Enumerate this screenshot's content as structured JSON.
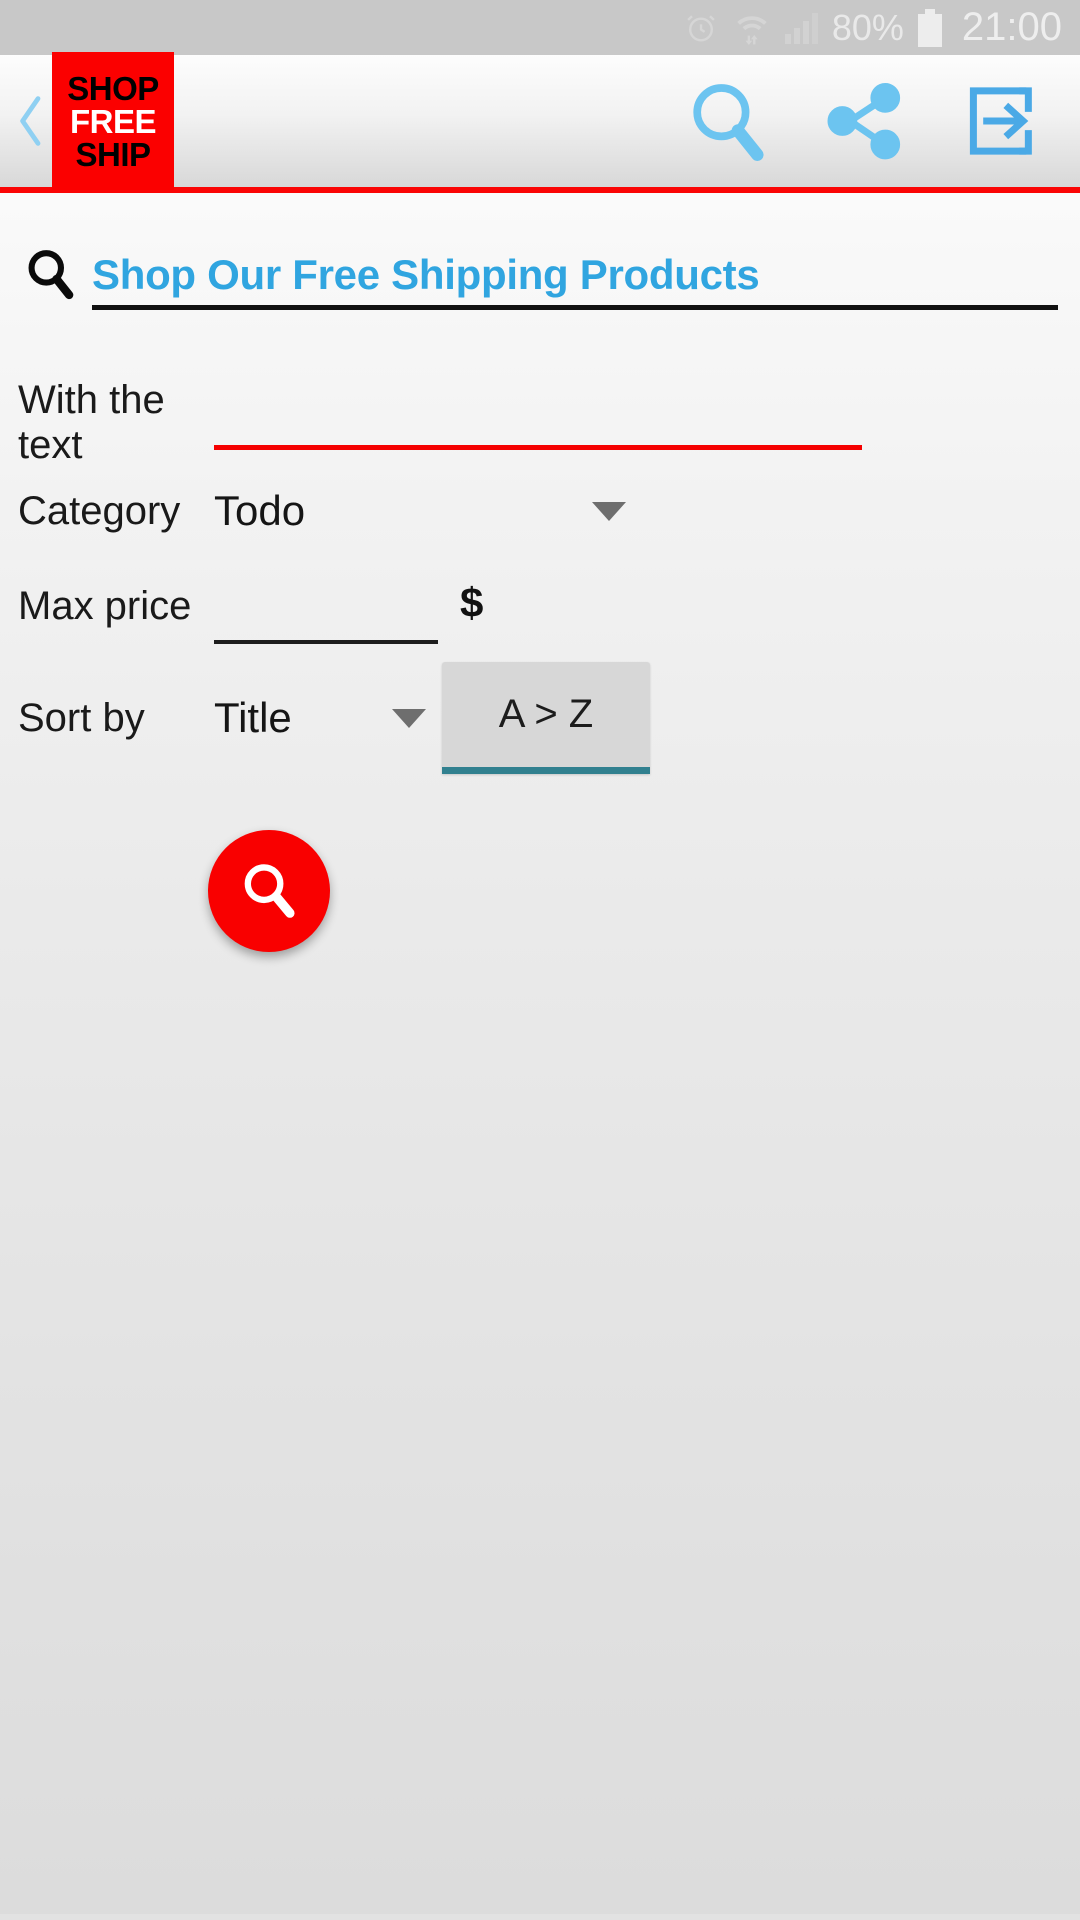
{
  "status_bar": {
    "battery_percent": "80%",
    "time": "21:00",
    "icons": [
      "alarm-icon",
      "wifi-icon",
      "signal-icon",
      "battery-icon"
    ]
  },
  "app_bar": {
    "back_label": "‹",
    "logo": {
      "line1": "SHOP",
      "line2": "FREE",
      "line3": "SHIP"
    },
    "actions": [
      {
        "name": "search-icon",
        "label": "Search"
      },
      {
        "name": "share-icon",
        "label": "Share"
      },
      {
        "name": "exit-icon",
        "label": "Exit"
      }
    ],
    "accent_color": "#fa0505"
  },
  "search_panel": {
    "heading": "Shop Our Free Shipping Products",
    "heading_color": "#30a5e0",
    "fields": {
      "text": {
        "label": "With the text",
        "value": "",
        "placeholder": "",
        "underline_color": "#f50000"
      },
      "category": {
        "label": "Category",
        "value": "Todo",
        "caret": "chevron-down-icon"
      },
      "max_price": {
        "label": "Max price",
        "value": "",
        "placeholder": "",
        "currency": "$",
        "underline_color": "#1d1d1d"
      },
      "sort_by": {
        "label": "Sort by",
        "value": "Title",
        "caret": "chevron-down-icon",
        "direction_button": "A > Z",
        "direction_accent": "#31808f"
      }
    },
    "submit_button": {
      "name": "search-fab",
      "color": "#f90000",
      "icon": "search-icon"
    }
  }
}
